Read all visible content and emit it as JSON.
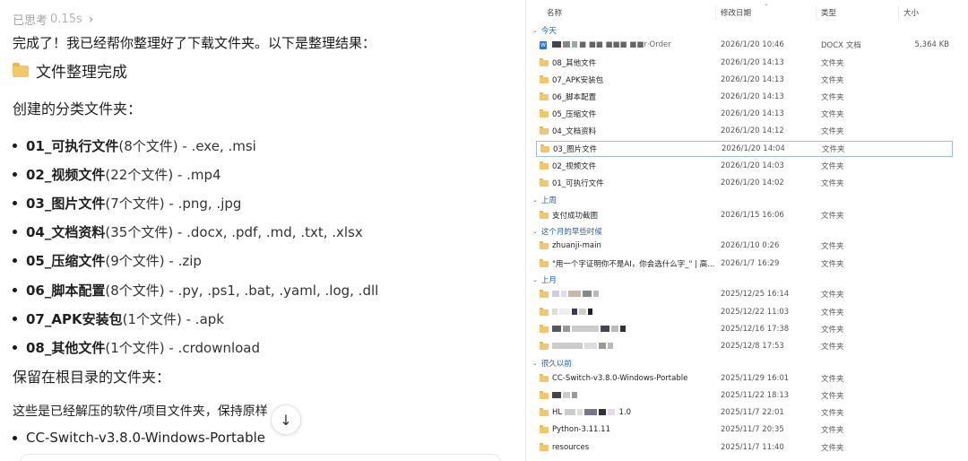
{
  "chat": {
    "thinking_label": "已思考",
    "thinking_time": "0.15s",
    "intro": "完成了！我已经帮你整理好了下载文件夹。以下是整理结果：",
    "heading": "文件整理完成",
    "categories_title": "创建的分类文件夹：",
    "categories": [
      {
        "name": "01_可执行文件",
        "detail": " (8个文件) - .exe, .msi"
      },
      {
        "name": "02_视频文件",
        "detail": " (22个文件) - .mp4"
      },
      {
        "name": "03_图片文件",
        "detail": " (7个文件) - .png, .jpg"
      },
      {
        "name": "04_文档资料",
        "detail": " (35个文件) - .docx, .pdf, .md, .txt, .xlsx"
      },
      {
        "name": "05_压缩文件",
        "detail": " (9个文件) - .zip"
      },
      {
        "name": "06_脚本配置",
        "detail": " (8个文件) - .py, .ps1, .bat, .yaml, .log, .dll"
      },
      {
        "name": "07_APK安装包",
        "detail": " (1个文件) - .apk"
      },
      {
        "name": "08_其他文件",
        "detail": " (1个文件) - .crdownload"
      }
    ],
    "kept_title": "保留在根目录的文件夹：",
    "kept_desc": "这些是已经解压的软件/项目文件夹，保持原样",
    "kept_first": "CC-Switch-v3.8.0-Windows-Portable"
  },
  "explorer": {
    "headers": {
      "name": "名称",
      "date": "修改日期",
      "type": "类型",
      "size": "大小"
    },
    "groups": {
      "today": "今天",
      "last_week": "上周",
      "earlier_month": "这个月的早些时候",
      "last_month": "上月",
      "long_ago": "很久以前"
    },
    "rows_today": [
      {
        "name": "■ ■■ ■■■ ■■r·Order",
        "date": "2026/1/20 10:46",
        "type": "DOCX 文档",
        "size": "5,364 KB",
        "icon": "docx"
      },
      {
        "name": "08_其他文件",
        "date": "2026/1/20 14:13",
        "type": "文件夹",
        "size": "",
        "icon": "folder"
      },
      {
        "name": "07_APK安装包",
        "date": "2026/1/20 14:13",
        "type": "文件夹",
        "size": "",
        "icon": "folder"
      },
      {
        "name": "06_脚本配置",
        "date": "2026/1/20 14:13",
        "type": "文件夹",
        "size": "",
        "icon": "folder"
      },
      {
        "name": "05_压缩文件",
        "date": "2026/1/20 14:13",
        "type": "文件夹",
        "size": "",
        "icon": "folder"
      },
      {
        "name": "04_文档资料",
        "date": "2026/1/20 14:12",
        "type": "文件夹",
        "size": "",
        "icon": "folder"
      },
      {
        "name": "03_图片文件",
        "date": "2026/1/20 14:04",
        "type": "文件夹",
        "size": "",
        "icon": "folder"
      },
      {
        "name": "02_视频文件",
        "date": "2026/1/20 14:03",
        "type": "文件夹",
        "size": "",
        "icon": "folder"
      },
      {
        "name": "01_可执行文件",
        "date": "2026/1/20 14:02",
        "type": "文件夹",
        "size": "",
        "icon": "folder"
      }
    ],
    "rows_last_week": [
      {
        "name": "支付成功截图",
        "date": "2026/1/15 16:06",
        "type": "文件夹",
        "size": "",
        "icon": "folder"
      }
    ],
    "rows_earlier_month": [
      {
        "name": "zhuanji-main",
        "date": "2026/1/10 0:26",
        "type": "文件夹",
        "size": "",
        "icon": "folder"
      },
      {
        "name": "\"用一个字证明你不是AI，你会选什么字_\" | 高...",
        "date": "2026/1/7 16:29",
        "type": "文件夹",
        "size": "",
        "icon": "folder"
      }
    ],
    "rows_last_month": [
      {
        "name": "",
        "date": "2025/12/25 16:14",
        "type": "文件夹",
        "size": "",
        "icon": "folder"
      },
      {
        "name": "",
        "date": "2025/12/22 11:03",
        "type": "文件夹",
        "size": "",
        "icon": "folder"
      },
      {
        "name": "",
        "date": "2025/12/16 17:38",
        "type": "文件夹",
        "size": "",
        "icon": "folder"
      },
      {
        "name": "",
        "date": "2025/12/8 17:53",
        "type": "文件夹",
        "size": "",
        "icon": "folder"
      }
    ],
    "rows_long_ago": [
      {
        "name": "CC-Switch-v3.8.0-Windows-Portable",
        "date": "2025/11/29 16:01",
        "type": "文件夹",
        "size": "",
        "icon": "folder"
      },
      {
        "name": "",
        "date": "2025/11/22 18:13",
        "type": "文件夹",
        "size": "",
        "icon": "folder"
      },
      {
        "name": "HL",
        "suffix": "1.0",
        "date": "2025/11/7 22:01",
        "type": "文件夹",
        "size": "",
        "icon": "folder"
      },
      {
        "name": "Python-3.11.11",
        "date": "2025/11/7 20:35",
        "type": "文件夹",
        "size": "",
        "icon": "folder"
      },
      {
        "name": "resources",
        "date": "2025/11/7 11:40",
        "type": "文件夹",
        "size": "",
        "icon": "folder"
      }
    ],
    "selected_row": "03_图片文件"
  }
}
